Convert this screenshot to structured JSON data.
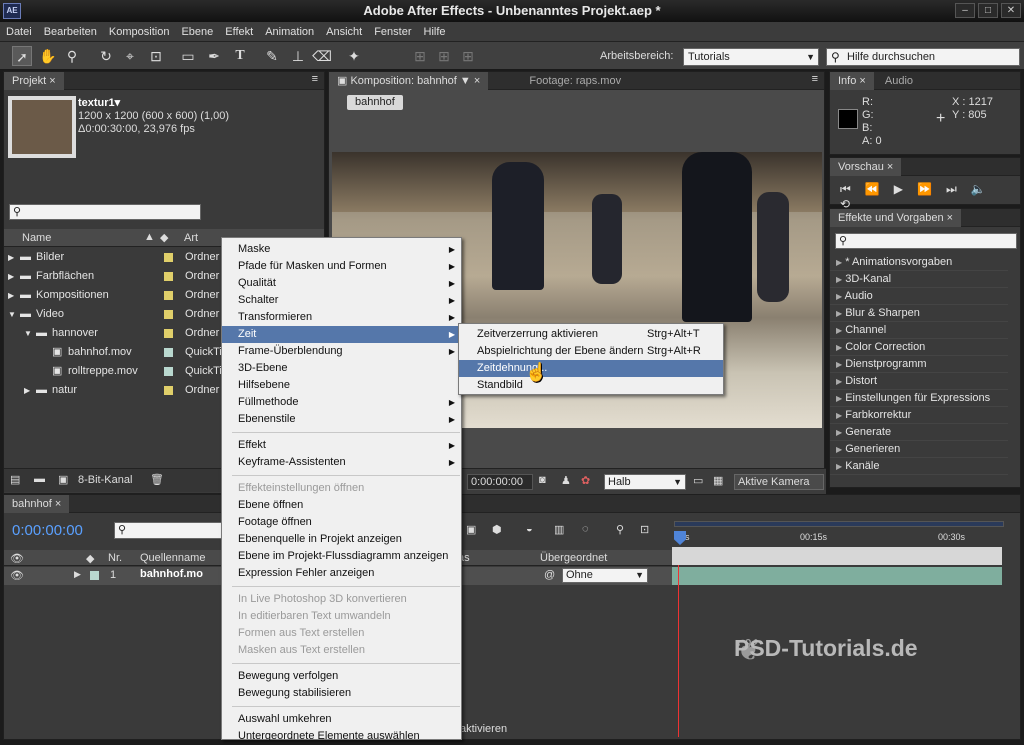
{
  "app": {
    "title": "Adobe After Effects - Unbenanntes Projekt.aep *",
    "logo": "AE"
  },
  "menubar": [
    "Datei",
    "Bearbeiten",
    "Komposition",
    "Ebene",
    "Effekt",
    "Animation",
    "Ansicht",
    "Fenster",
    "Hilfe"
  ],
  "toolbar": {
    "workspace_label": "Arbeitsbereich:",
    "workspace_value": "Tutorials",
    "help_placeholder": "Hilfe durchsuchen"
  },
  "project": {
    "tab": "Projekt",
    "item_name": "textur1▾",
    "item_line1": "1200 x 1200 (600 x 600) (1,00)",
    "item_line2": "Δ0:00:30:00, 23,976 fps",
    "col_name": "Name",
    "col_type": "Art",
    "rows": [
      {
        "name": "Bilder",
        "type": "Ordner",
        "color": "#e0cf6a"
      },
      {
        "name": "Farbflächen",
        "type": "Ordner",
        "color": "#e0cf6a"
      },
      {
        "name": "Kompositionen",
        "type": "Ordner",
        "color": "#e0cf6a"
      },
      {
        "name": "Video",
        "type": "Ordner",
        "color": "#e0cf6a"
      },
      {
        "name": "hannover",
        "type": "Ordner",
        "color": "#e0cf6a"
      },
      {
        "name": "bahnhof.mov",
        "type": "QuickTi",
        "color": "#b9d8cf"
      },
      {
        "name": "rolltreppe.mov",
        "type": "QuickTi",
        "color": "#b9d8cf"
      },
      {
        "name": "natur",
        "type": "Ordner",
        "color": "#e0cf6a"
      }
    ],
    "bpc": "8-Bit-Kanal"
  },
  "comp": {
    "tab": "Komposition: bahnhof",
    "footage_tab": "Footage: raps.mov",
    "chip": "bahnhof",
    "timecode": "0:00:00:00",
    "resolution": "Halb",
    "camera": "Aktive Kamera"
  },
  "info": {
    "tab": "Info",
    "tab2": "Audio",
    "r": "R:",
    "g": "G:",
    "b": "B:",
    "a": "A:  0",
    "x": "X : 1217",
    "y": "Y : 805"
  },
  "preview": {
    "tab": "Vorschau"
  },
  "effects": {
    "tab": "Effekte und Vorgaben",
    "items": [
      "* Animationsvorgaben",
      "3D-Kanal",
      "Audio",
      "Blur & Sharpen",
      "Channel",
      "Color Correction",
      "Dienstprogramm",
      "Distort",
      "Einstellungen für Expressions",
      "Farbkorrektur",
      "Generate",
      "Generieren",
      "Kanäle"
    ]
  },
  "timeline": {
    "tab": "bahnhof",
    "timecode": "0:00:00:00",
    "col_nr": "Nr.",
    "col_source": "Quellenname",
    "col_parent": "Übergeordnet",
    "layer_num": "1",
    "layer_name": "bahnhof.mo",
    "parent_value": "Ohne",
    "ruler": [
      "0s",
      "00:15s",
      "00:30s"
    ],
    "bottom_label": "aktivieren",
    "mode_label": "as"
  },
  "context_menu": {
    "items": [
      {
        "label": "Maske",
        "sub": true,
        "disabled": false
      },
      {
        "label": "Pfade für Masken und Formen",
        "sub": true,
        "disabled": false
      },
      {
        "label": "Qualität",
        "sub": true,
        "disabled": false
      },
      {
        "label": "Schalter",
        "sub": true,
        "disabled": false
      },
      {
        "label": "Transformieren",
        "sub": true,
        "disabled": false
      },
      {
        "label": "Zeit",
        "sub": true,
        "disabled": false,
        "highlight": true
      },
      {
        "label": "Frame-Überblendung",
        "sub": true,
        "disabled": false
      },
      {
        "label": "3D-Ebene",
        "sub": false,
        "disabled": false
      },
      {
        "label": "Hilfsebene",
        "sub": false,
        "disabled": false
      },
      {
        "label": "Füllmethode",
        "sub": true,
        "disabled": false
      },
      {
        "label": "Ebenenstile",
        "sub": true,
        "disabled": false
      },
      {
        "sep": true
      },
      {
        "label": "Effekt",
        "sub": true,
        "disabled": false
      },
      {
        "label": "Keyframe-Assistenten",
        "sub": true,
        "disabled": false
      },
      {
        "sep": true
      },
      {
        "label": "Effekteinstellungen öffnen",
        "sub": false,
        "disabled": true
      },
      {
        "label": "Ebene öffnen",
        "sub": false,
        "disabled": false
      },
      {
        "label": "Footage öffnen",
        "sub": false,
        "disabled": false
      },
      {
        "label": "Ebenenquelle in Projekt anzeigen",
        "sub": false,
        "disabled": false
      },
      {
        "label": "Ebene im Projekt-Flussdiagramm anzeigen",
        "sub": false,
        "disabled": false
      },
      {
        "label": "Expression Fehler anzeigen",
        "sub": false,
        "disabled": false
      },
      {
        "sep": true
      },
      {
        "label": "In Live Photoshop 3D konvertieren",
        "sub": false,
        "disabled": true
      },
      {
        "label": "In editierbaren Text umwandeln",
        "sub": false,
        "disabled": true
      },
      {
        "label": "Formen aus Text erstellen",
        "sub": false,
        "disabled": true
      },
      {
        "label": "Masken aus Text erstellen",
        "sub": false,
        "disabled": true
      },
      {
        "sep": true
      },
      {
        "label": "Bewegung verfolgen",
        "sub": false,
        "disabled": false
      },
      {
        "label": "Bewegung stabilisieren",
        "sub": false,
        "disabled": false
      },
      {
        "sep": true
      },
      {
        "label": "Auswahl umkehren",
        "sub": false,
        "disabled": false
      },
      {
        "label": "Untergeordnete Elemente auswählen",
        "sub": false,
        "disabled": false
      }
    ]
  },
  "submenu": {
    "items": [
      {
        "label": "Zeitverzerrung aktivieren",
        "shortcut": "Strg+Alt+T"
      },
      {
        "label": "Abspielrichtung der Ebene ändern",
        "shortcut": "Strg+Alt+R"
      },
      {
        "label": "Zeitdehnung...",
        "shortcut": "",
        "highlight": true
      },
      {
        "label": "Standbild",
        "shortcut": ""
      }
    ]
  },
  "watermark": "PSD-Tutorials.de"
}
